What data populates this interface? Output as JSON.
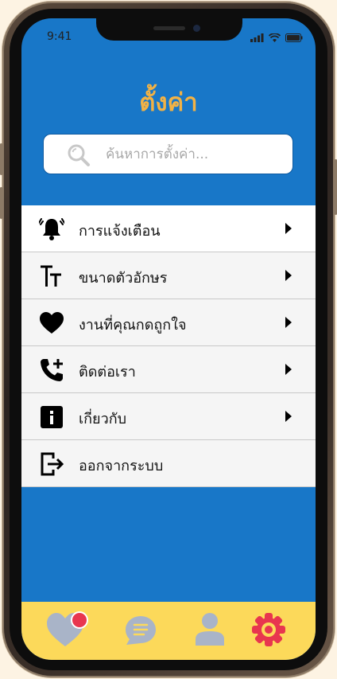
{
  "status": {
    "time": "9:41"
  },
  "page": {
    "title": "ตั้งค่า"
  },
  "search": {
    "placeholder": "ค้นหาการตั้งค่า..."
  },
  "menu": {
    "items": [
      {
        "label": "การแจ้งเตือน",
        "icon": "bell-icon"
      },
      {
        "label": "ขนาดตัวอักษร",
        "icon": "text-size-icon"
      },
      {
        "label": "งานที่คุณกดถูกใจ",
        "icon": "heart-icon"
      },
      {
        "label": "ติดต่อเรา",
        "icon": "phone-add-icon"
      },
      {
        "label": "เกี่ยวกับ",
        "icon": "info-icon"
      },
      {
        "label": "ออกจากระบบ",
        "icon": "logout-icon"
      }
    ]
  },
  "tabbar": {
    "tabs": [
      {
        "icon": "heart-icon",
        "active": false,
        "badge": true
      },
      {
        "icon": "chat-icon",
        "active": false
      },
      {
        "icon": "user-icon",
        "active": false
      },
      {
        "icon": "gear-icon",
        "active": true
      }
    ]
  },
  "colors": {
    "header_bg": "#1877c8",
    "title": "#f2b245",
    "tabbar_bg": "#fcd95a",
    "active_tab": "#e8364f",
    "inactive_tab": "#a9b4c8"
  }
}
